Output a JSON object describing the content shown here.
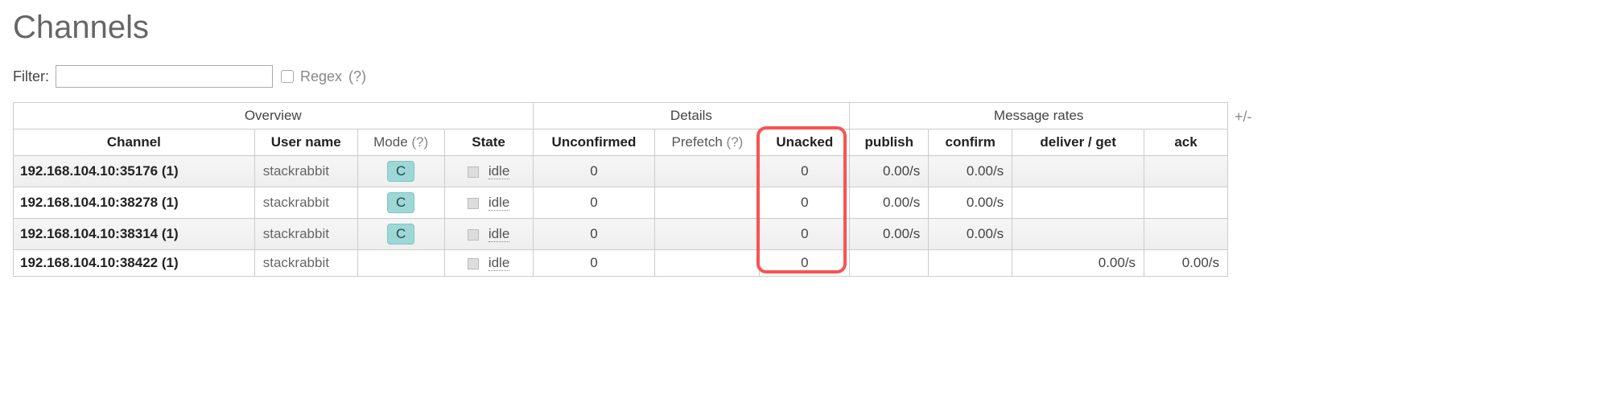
{
  "title": "Channels",
  "filter": {
    "label": "Filter:",
    "value": "",
    "regex_label": "Regex",
    "help": "(?)"
  },
  "table": {
    "groups": [
      "Overview",
      "Details",
      "Message rates"
    ],
    "columns": {
      "channel": "Channel",
      "user": "User name",
      "mode": "Mode",
      "mode_help": "(?)",
      "state": "State",
      "unconfirmed": "Unconfirmed",
      "prefetch": "Prefetch",
      "prefetch_help": "(?)",
      "unacked": "Unacked",
      "publish": "publish",
      "confirm": "confirm",
      "deliver_get": "deliver / get",
      "ack": "ack"
    },
    "rows": [
      {
        "channel": "192.168.104.10:35176 (1)",
        "user": "stackrabbit",
        "mode": "C",
        "state": "idle",
        "unconfirmed": "0",
        "prefetch": "",
        "unacked": "0",
        "publish": "0.00/s",
        "confirm": "0.00/s",
        "deliver_get": "",
        "ack": ""
      },
      {
        "channel": "192.168.104.10:38278 (1)",
        "user": "stackrabbit",
        "mode": "C",
        "state": "idle",
        "unconfirmed": "0",
        "prefetch": "",
        "unacked": "0",
        "publish": "0.00/s",
        "confirm": "0.00/s",
        "deliver_get": "",
        "ack": ""
      },
      {
        "channel": "192.168.104.10:38314 (1)",
        "user": "stackrabbit",
        "mode": "C",
        "state": "idle",
        "unconfirmed": "0",
        "prefetch": "",
        "unacked": "0",
        "publish": "0.00/s",
        "confirm": "0.00/s",
        "deliver_get": "",
        "ack": ""
      },
      {
        "channel": "192.168.104.10:38422 (1)",
        "user": "stackrabbit",
        "mode": "",
        "state": "idle",
        "unconfirmed": "0",
        "prefetch": "",
        "unacked": "0",
        "publish": "",
        "confirm": "",
        "deliver_get": "0.00/s",
        "ack": "0.00/s"
      }
    ],
    "expand_toggle": "+/-"
  }
}
